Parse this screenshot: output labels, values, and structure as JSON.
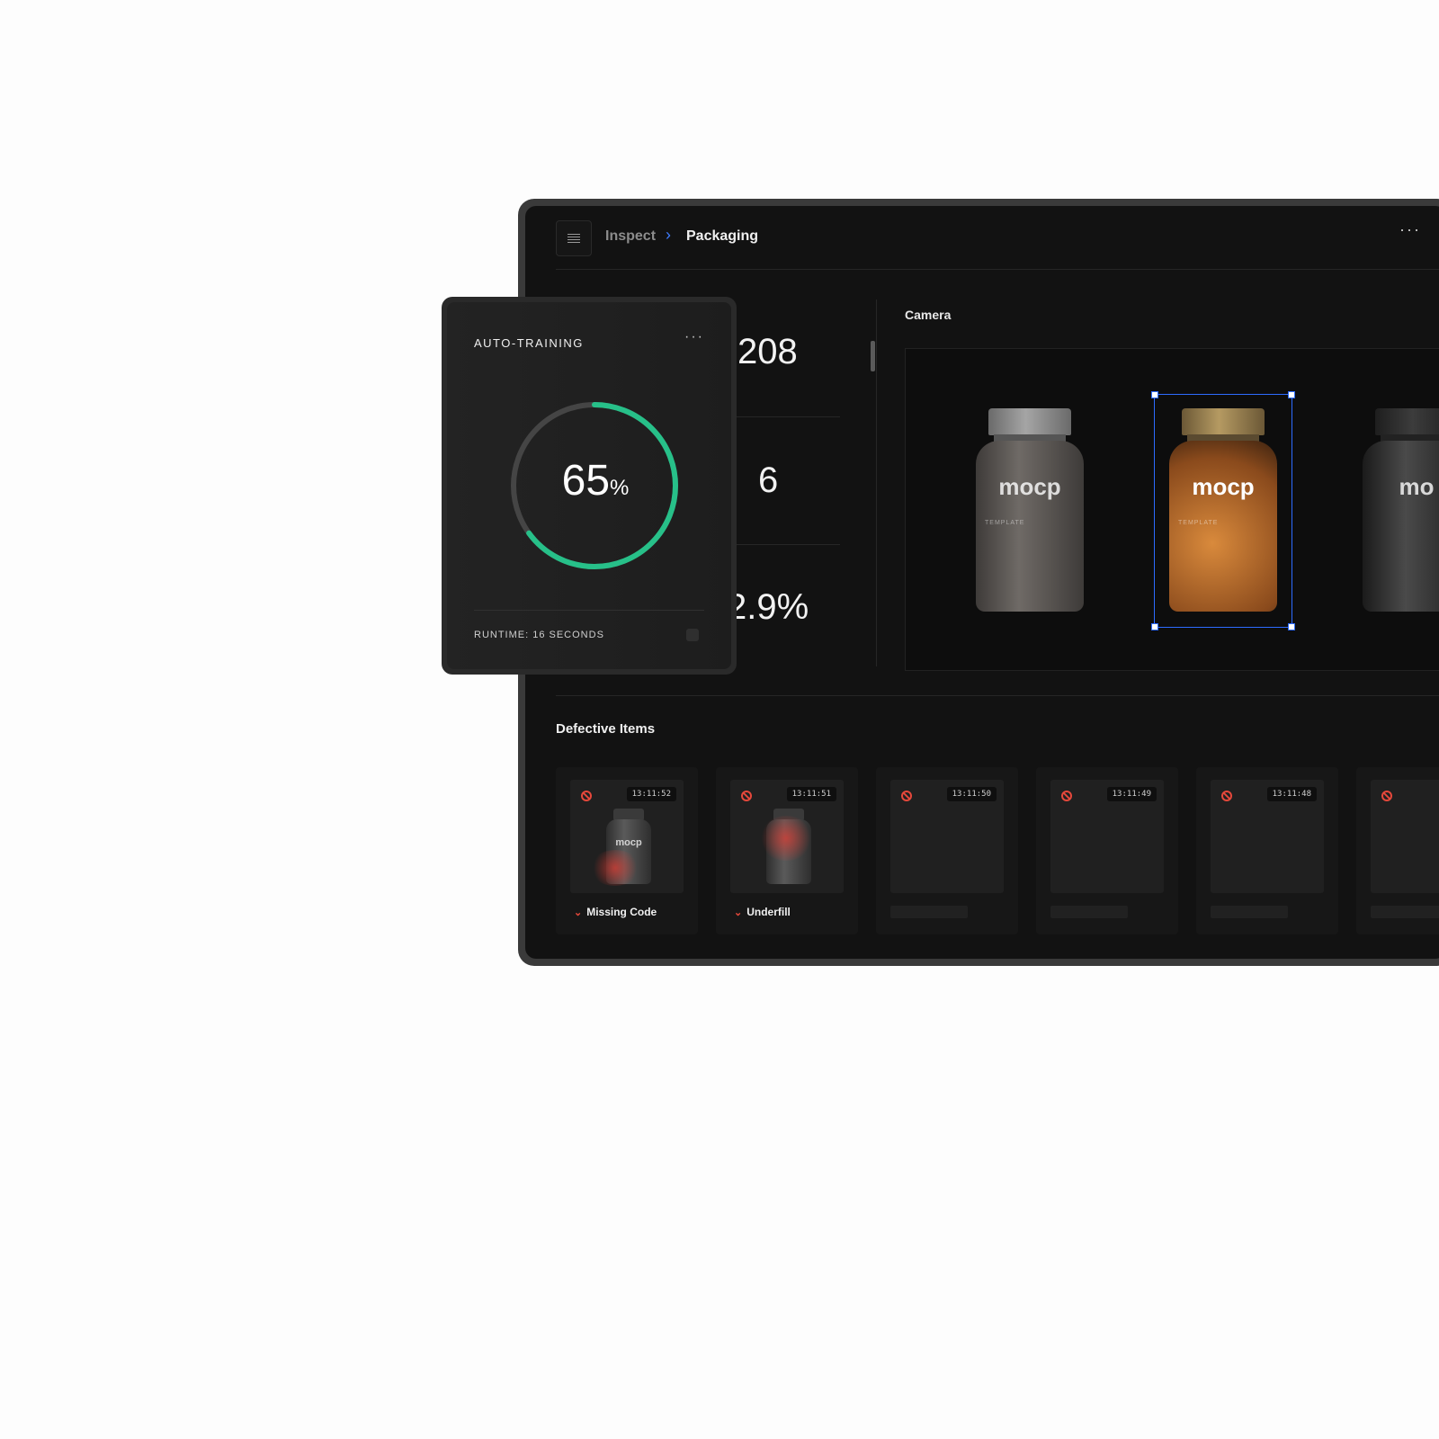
{
  "breadcrumb": {
    "parent": "Inspect",
    "separator": "›",
    "current": "Packaging"
  },
  "header": {
    "more": "···"
  },
  "stats": {
    "total": "208",
    "defects": "6",
    "rate": "2.9%"
  },
  "camera": {
    "title": "Camera",
    "bottles": [
      {
        "brand": "mocp",
        "subtitle": "TEMPLATE"
      },
      {
        "brand": "mocp",
        "subtitle": "TEMPLATE",
        "selected": true
      },
      {
        "brand": "mo"
      }
    ]
  },
  "defects": {
    "title": "Defective Items",
    "items": [
      {
        "time": "13:11:52",
        "label": "Missing Code"
      },
      {
        "time": "13:11:51",
        "label": "Underfill"
      },
      {
        "time": "13:11:50",
        "label": ""
      },
      {
        "time": "13:11:49",
        "label": ""
      },
      {
        "time": "13:11:48",
        "label": ""
      }
    ]
  },
  "auto_training": {
    "title": "AUTO-TRAINING",
    "more": "···",
    "progress_value": "65",
    "progress_fraction": 0.65,
    "progress_symbol": "%",
    "runtime": "RUNTIME: 16 SECONDS"
  },
  "colors": {
    "accent": "#27c089",
    "selection": "#2d6bff",
    "defect": "#e5483b"
  }
}
